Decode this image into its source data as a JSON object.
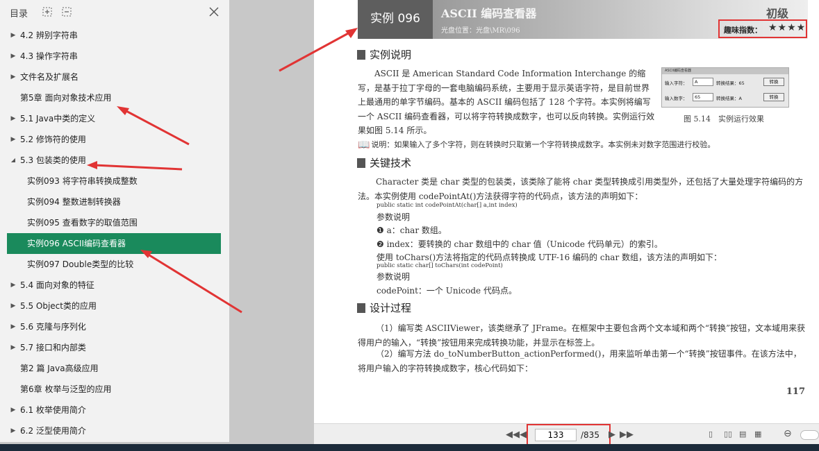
{
  "sidebar": {
    "title": "目录",
    "icons": [
      "expand-all-icon",
      "collapse-all-icon",
      "close-icon"
    ],
    "items": [
      {
        "label": "4.2 辨别字符串",
        "arrow": "▶"
      },
      {
        "label": "4.3 操作字符串",
        "arrow": "▶"
      },
      {
        "label": "文件名及扩展名",
        "arrow": "▶"
      },
      {
        "label": "第5章 面向对象技术应用",
        "arrow": ""
      },
      {
        "label": "5.1 Java中类的定义",
        "arrow": "▶"
      },
      {
        "label": "5.2 修饰符的使用",
        "arrow": "▶"
      },
      {
        "label": "5.3 包装类的使用",
        "arrow": "◢"
      },
      {
        "label": "实例093 将字符串转换成整数",
        "arrow": ""
      },
      {
        "label": "实例094 整数进制转换器",
        "arrow": ""
      },
      {
        "label": "实例095 查看数字的取值范围",
        "arrow": ""
      },
      {
        "label": "实例096 ASCII编码查看器",
        "arrow": "",
        "active": true
      },
      {
        "label": "实例097 Double类型的比较",
        "arrow": ""
      },
      {
        "label": "5.4 面向对象的特征",
        "arrow": "▶"
      },
      {
        "label": "5.5 Object类的应用",
        "arrow": "▶"
      },
      {
        "label": "5.6 克隆与序列化",
        "arrow": "▶"
      },
      {
        "label": "5.7 接口和内部类",
        "arrow": "▶"
      },
      {
        "label": "第2 篇 Java高级应用",
        "arrow": ""
      },
      {
        "label": "第6章 枚举与泛型的应用",
        "arrow": ""
      },
      {
        "label": "6.1 枚举使用简介",
        "arrow": "▶"
      },
      {
        "label": "6.2 泛型使用简介",
        "arrow": "▶"
      }
    ]
  },
  "page": {
    "example_no": "实例 096",
    "example_name": "ASCII 编码查看器",
    "location": "光盘位置：光盘\\MR\\096",
    "level": "初级",
    "fun_label": "趣味指数：",
    "fun_stars": "★★★★",
    "sec1": "实例说明",
    "p1": "ASCII 是 American Standard Code Information Interchange 的缩写，是基于拉丁字母的一套电脑编码系统，主要用于显示英语字符，是目前世界上最通用的单字节编码。基本的 ASCII 编码包括了 128 个字符。本实例将编写一个 ASCII 编码查看器，可以将字符转换成数字，也可以反向转换。实例运行效果如图 5.14 所示。",
    "figure": {
      "title": "ASCII编码查看器",
      "row1": {
        "label": "输入字符：",
        "value": "A",
        "result": "转换结果：65",
        "button": "转换"
      },
      "row2": {
        "label": "输入数字：",
        "value": "65",
        "result": "转换结果：A",
        "button": "转换"
      },
      "caption": "图 5.14　实例运行效果"
    },
    "note": "说明：如果输入了多个字符，则在转换时只取第一个字符转换成数字。本实例未对数字范围进行校验。",
    "sec2": "关键技术",
    "p2": "Character 类是 char 类型的包装类，该类除了能将 char 类型转换成引用类型外，还包括了大量处理字符编码的方法。本实例使用 codePointAt()方法获得字符的代码点，该方法的声明如下：",
    "code1": "public static int codePointAt(char[] a,int index)",
    "param1": "参数说明",
    "param1a": "❶ a：char 数组。",
    "param1b": "❷ index：要转换的 char 数组中的 char 值（Unicode 代码单元）的索引。",
    "p3": "使用 toChars()方法将指定的代码点转换成 UTF-16 编码的 char 数组，该方法的声明如下：",
    "code2": "public static char[] toChars(int codePoint)",
    "param2": "参数说明",
    "param2a": "codePoint：一个 Unicode 代码点。",
    "sec3": "设计过程",
    "p4": "（1）编写类 ASCIIViewer，该类继承了 JFrame。在框架中主要包含两个文本域和两个“转换”按钮，文本域用来获得用户的输入，“转换”按钮用来完成转换功能，并显示在标签上。",
    "p5": "（2）编写方法 do_toNumberButton_actionPerformed()，用来监听单击第一个“转换”按钮事件。在该方法中，将用户输入的字符转换成数字，核心代码如下：",
    "page_number": "117"
  },
  "navbar": {
    "current_page": "133",
    "total_pages": "/835"
  },
  "colors": {
    "active_item": "#1a8a5c",
    "annotation_red": "#e13434"
  }
}
